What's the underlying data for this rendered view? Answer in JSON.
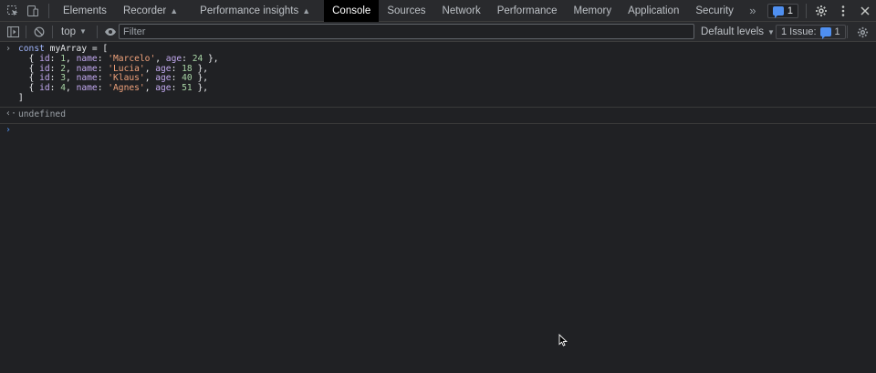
{
  "tabbar": {
    "tabs": [
      {
        "label": "Elements"
      },
      {
        "label": "Recorder"
      },
      {
        "label": "Performance insights"
      },
      {
        "label": "Console"
      },
      {
        "label": "Sources"
      },
      {
        "label": "Network"
      },
      {
        "label": "Performance"
      },
      {
        "label": "Memory"
      },
      {
        "label": "Application"
      },
      {
        "label": "Security"
      }
    ],
    "active_tab": "Console",
    "more_tabs_icon": "chevron-double-right-icon",
    "message_count": "1"
  },
  "console_toolbar": {
    "context": "top",
    "filter_placeholder": "Filter",
    "levels": "Default levels",
    "issues_label": "1 Issue:",
    "issues_count": "1"
  },
  "console": {
    "input_lines": [
      "const myArray = [",
      "  { id: 1, name: 'Marcelo', age: 24 },",
      "  { id: 2, name: 'Lucia', age: 18 },",
      "  { id: 3, name: 'Klaus', age: 40 },",
      "  { id: 4, name: 'Agnes', age: 51 },",
      "]"
    ],
    "rows": [
      {
        "id": "1",
        "name": "'Marcelo'",
        "age": "24"
      },
      {
        "id": "2",
        "name": "'Lucia'",
        "age": "18"
      },
      {
        "id": "3",
        "name": "'Klaus'",
        "age": "40"
      },
      {
        "id": "4",
        "name": "'Agnes'",
        "age": "51"
      }
    ],
    "result": "undefined"
  },
  "colors": {
    "background": "#202124",
    "toolbar": "#292a2d",
    "active_tab": "#000000",
    "accent": "#4f8ff0",
    "string": "#f0a27b",
    "number": "#a9d6a6",
    "property": "#c2a9f0",
    "keyword": "#9fb4f9"
  }
}
